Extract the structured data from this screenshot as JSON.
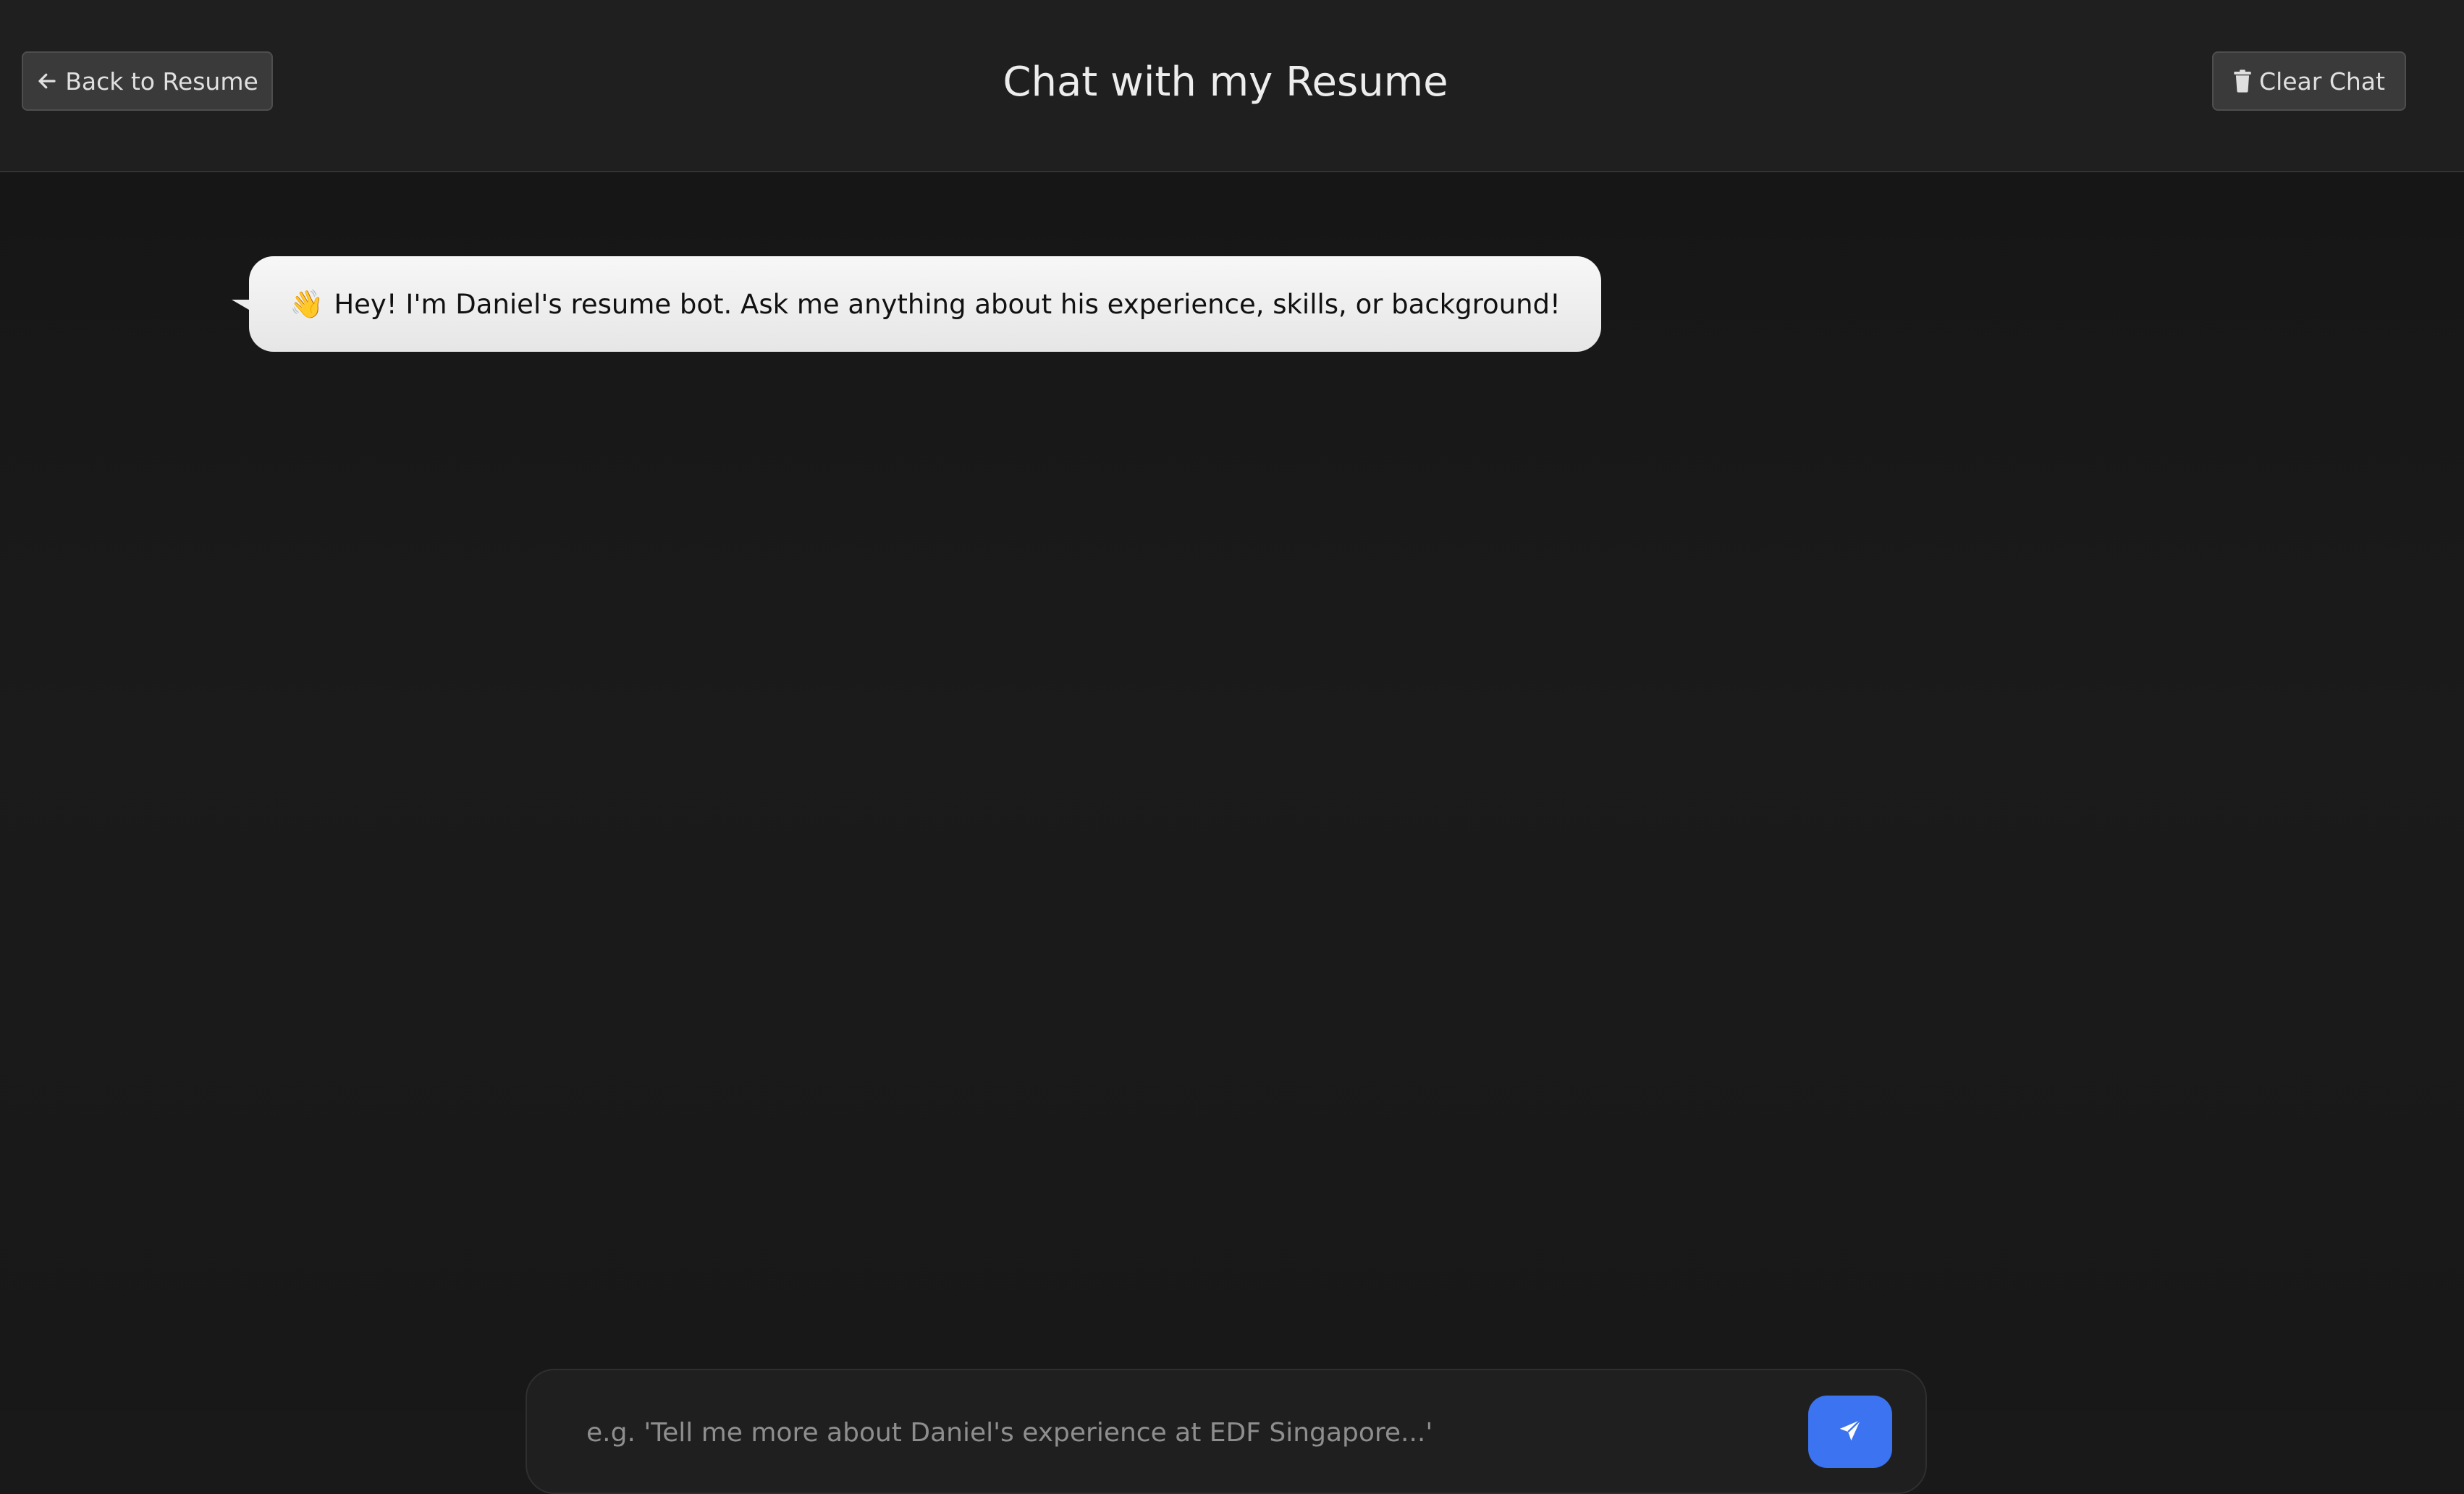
{
  "header": {
    "title": "Chat with my Resume",
    "back_label": "Back to Resume",
    "back_icon": "arrow-left-icon",
    "clear_label": "Clear Chat",
    "clear_icon": "trash-icon"
  },
  "chat": {
    "messages": [
      {
        "sender": "bot",
        "emoji": "👋",
        "text": "Hey! I'm Daniel's resume bot. Ask me anything about his experience, skills, or background!"
      }
    ]
  },
  "composer": {
    "value": "",
    "placeholder": "e.g. 'Tell me more about Daniel's experience at EDF Singapore...'",
    "send_icon": "paper-plane-icon"
  },
  "colors": {
    "background": "#191919",
    "header_bg": "#1f1f1f",
    "bubble_bg": "#eeeeee",
    "accent": "#3b73f0"
  }
}
